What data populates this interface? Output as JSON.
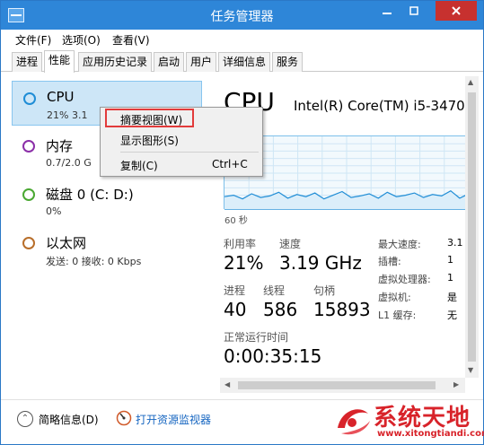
{
  "window": {
    "title": "任务管理器"
  },
  "menu": [
    "文件(F)",
    "选项(O)",
    "查看(V)"
  ],
  "tabs": [
    "进程",
    "性能",
    "应用历史记录",
    "启动",
    "用户",
    "详细信息",
    "服务"
  ],
  "active_tab": "性能",
  "resources": [
    {
      "name": "CPU",
      "sub": "21% 3.1",
      "color": "#1f8dd6",
      "selected": true
    },
    {
      "name": "内存",
      "sub": "0.7/2.0 G",
      "color": "#8b2fa8"
    },
    {
      "name": "磁盘 0 (C: D:)",
      "sub": "0%",
      "color": "#4aa832"
    },
    {
      "name": "以太网",
      "sub": "发送: 0 接收: 0 Kbps",
      "color": "#b86e2a"
    }
  ],
  "context_menu": {
    "items": [
      "摘要视图(W)",
      "显示图形(S)",
      "复制(C)"
    ],
    "shortcut": "Ctrl+C"
  },
  "detail": {
    "title": "CPU",
    "model": "Intel(R) Core(TM) i5-3470",
    "graph_time_label": "60 秒",
    "utilization_label": "利用率",
    "utilization_value": "21%",
    "speed_label": "速度",
    "speed_value": "3.19 GHz",
    "processes_label": "进程",
    "processes_value": "40",
    "threads_label": "线程",
    "threads_value": "586",
    "handles_label": "句柄",
    "handles_value": "15893",
    "uptime_label": "正常运行时间",
    "uptime_value": "0:00:35:15",
    "specs": [
      {
        "label": "最大速度:",
        "value": "3.1"
      },
      {
        "label": "插槽:",
        "value": "1"
      },
      {
        "label": "虚拟处理器:",
        "value": "1"
      },
      {
        "label": "虚拟机:",
        "value": "是"
      },
      {
        "label": "L1 缓存:",
        "value": "无"
      }
    ],
    "graph_series": [
      18,
      20,
      15,
      22,
      17,
      19,
      24,
      16,
      21,
      18,
      23,
      15,
      20,
      25,
      17,
      19,
      22,
      16,
      24,
      18,
      20,
      23,
      17,
      21,
      19,
      26,
      16,
      22
    ]
  },
  "bottom": {
    "fewer_details": "简略信息(D)",
    "open_monitor": "打开资源监视器"
  },
  "watermark": {
    "text": "系统天地",
    "url": "www.xitongtiandi.com"
  },
  "colors": {
    "titlebar": "#2e86d8",
    "accent": "#1f8dd6",
    "watermark": "#d8232a"
  }
}
